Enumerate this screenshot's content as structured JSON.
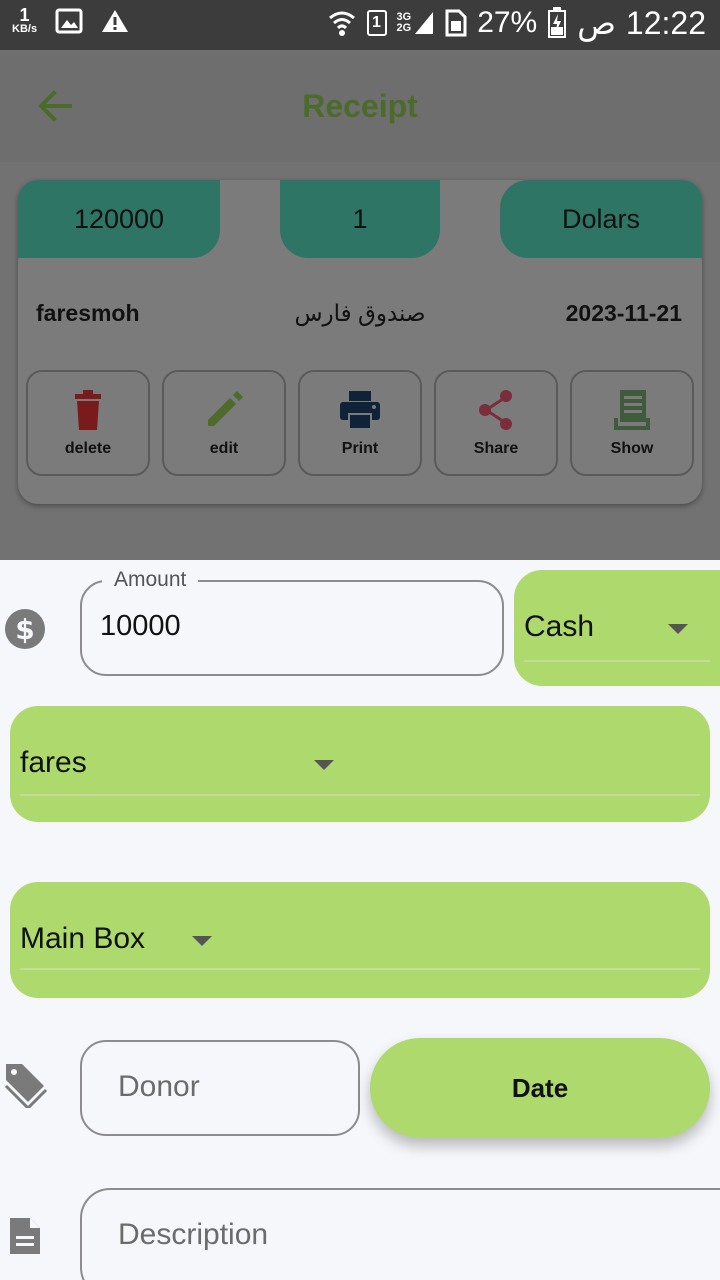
{
  "status_bar": {
    "speed_value": "1",
    "speed_unit": "KB/s",
    "sim_slot": "1",
    "network_top": "3G",
    "network_bottom": "2G",
    "battery_percent": "27%",
    "ampm": "ص",
    "time": "12:22"
  },
  "app_bar": {
    "title": "Receipt",
    "back_icon": "arrow-left-icon"
  },
  "card": {
    "amount": "120000",
    "number": "1",
    "currency": "Dolars",
    "user": "faresmoh",
    "box_name": "صندوق فارس",
    "date": "2023-11-21",
    "actions": [
      {
        "label": "delete",
        "icon": "trash-icon",
        "color": "#7a1b1b"
      },
      {
        "label": "edit",
        "icon": "pencil-icon",
        "color": "#4e6b2a"
      },
      {
        "label": "Print",
        "icon": "printer-icon",
        "color": "#0e2238"
      },
      {
        "label": "Share",
        "icon": "share-icon",
        "color": "#7a2e3c"
      },
      {
        "label": "Show",
        "icon": "receipt-icon",
        "color": "#3f5a3c"
      }
    ]
  },
  "form": {
    "amount_label": "Amount",
    "amount_value": "10000",
    "payment_type": "Cash",
    "user_select": "fares",
    "box_select": "Main Box",
    "donor_placeholder": "Donor",
    "date_button": "Date",
    "description_placeholder": "Description"
  },
  "colors": {
    "accent_green": "#aed96c",
    "tab_teal": "#2e7565",
    "title_green": "#4b6b2a"
  }
}
